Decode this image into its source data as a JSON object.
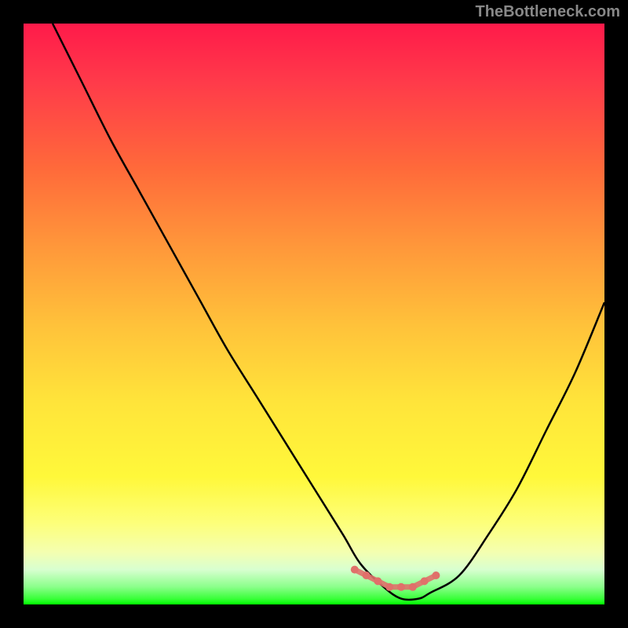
{
  "watermark": "TheBottleneck.com",
  "chart_data": {
    "type": "line",
    "title": "",
    "xlabel": "",
    "ylabel": "",
    "xlim": [
      0,
      100
    ],
    "ylim": [
      0,
      100
    ],
    "gradient_meaning": "background maps y-value: top=red(high bottleneck), bottom=green(low bottleneck)",
    "series": [
      {
        "name": "bottleneck-curve",
        "color": "#000000",
        "x": [
          5,
          10,
          15,
          20,
          25,
          30,
          35,
          40,
          45,
          50,
          55,
          58,
          62,
          65,
          68,
          70,
          75,
          80,
          85,
          90,
          95,
          100
        ],
        "values": [
          100,
          90,
          80,
          71,
          62,
          53,
          44,
          36,
          28,
          20,
          12,
          7,
          3,
          1,
          1,
          2,
          5,
          12,
          20,
          30,
          40,
          52
        ]
      },
      {
        "name": "highlight-range",
        "color": "#e0706a",
        "type": "scatter",
        "x": [
          57,
          59,
          61,
          63,
          65,
          67,
          69,
          71
        ],
        "values": [
          6,
          5,
          4,
          3,
          3,
          3,
          4,
          5
        ]
      }
    ]
  }
}
